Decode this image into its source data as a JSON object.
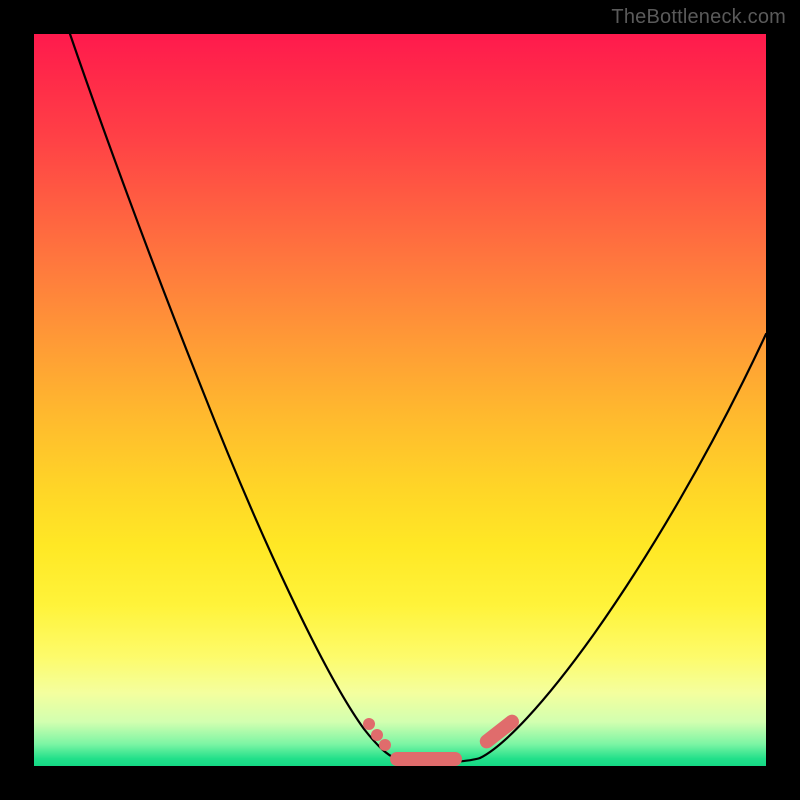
{
  "watermark": {
    "text": "TheBottleneck.com"
  },
  "chart_data": {
    "type": "line",
    "title": "",
    "xlabel": "",
    "ylabel": "",
    "xlim": [
      0,
      100
    ],
    "ylim": [
      0,
      100
    ],
    "grid": false,
    "legend": false,
    "background": "rainbow-gradient-vertical-red-to-green",
    "series": [
      {
        "name": "left-branch",
        "x": [
          5,
          10,
          15,
          20,
          25,
          30,
          35,
          40,
          45,
          47,
          49,
          50
        ],
        "y": [
          100,
          86,
          73,
          60,
          48,
          37,
          27,
          18,
          9,
          5,
          2,
          1
        ]
      },
      {
        "name": "right-branch",
        "x": [
          60,
          63,
          67,
          72,
          78,
          84,
          90,
          96,
          100
        ],
        "y": [
          1,
          3,
          7,
          13,
          22,
          32,
          43,
          54,
          60
        ]
      },
      {
        "name": "valley-floor",
        "x": [
          50,
          52,
          54,
          56,
          58,
          60
        ],
        "y": [
          1,
          0.5,
          0.5,
          0.5,
          0.7,
          1
        ]
      }
    ],
    "markers": {
      "color": "#e06c6c",
      "points": [
        {
          "x": 46,
          "y": 6
        },
        {
          "x": 47,
          "y": 4
        },
        {
          "x": 48,
          "y": 2.5
        }
      ],
      "pills": [
        {
          "x1": 49,
          "x2": 57,
          "y": 0.8
        },
        {
          "x1": 59,
          "x2": 63,
          "y": 2.5,
          "slope": 4
        }
      ]
    }
  }
}
